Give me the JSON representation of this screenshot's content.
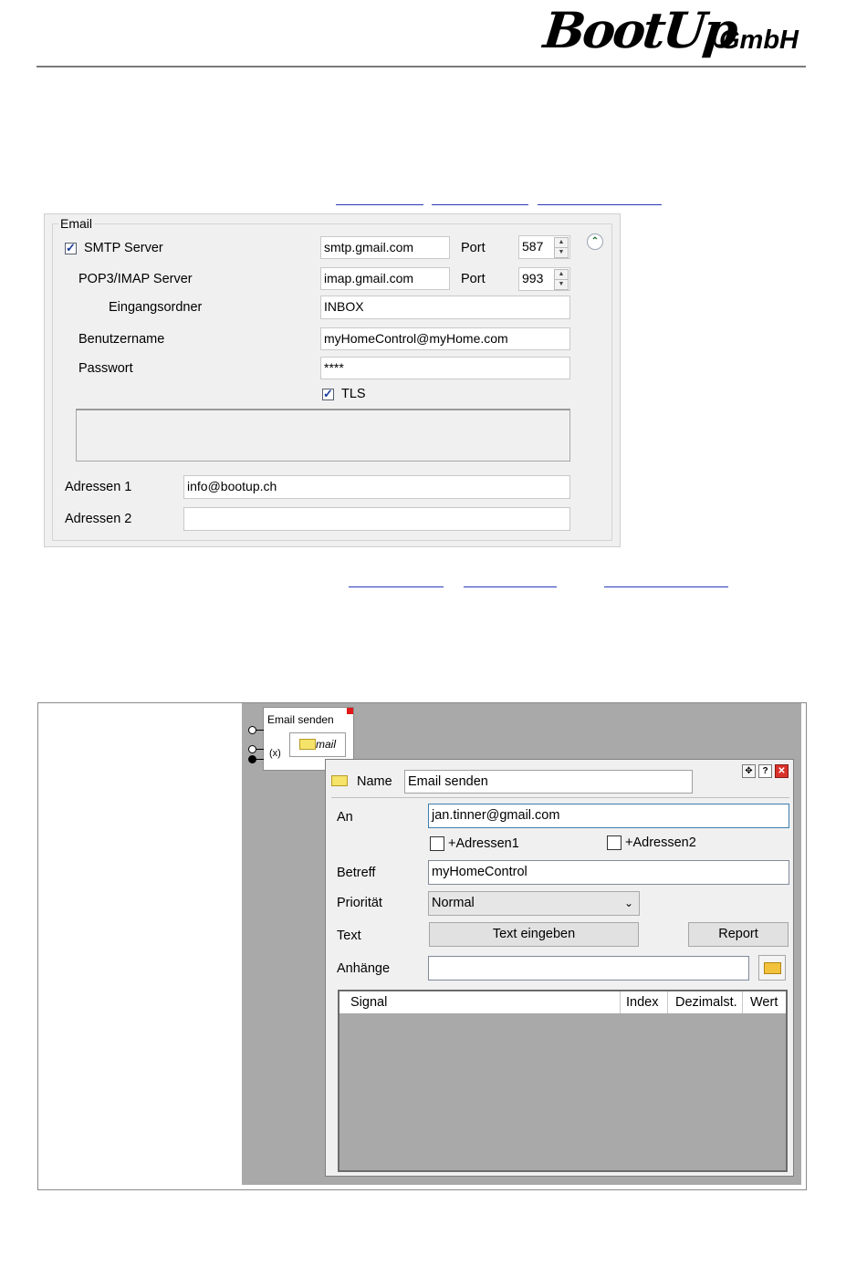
{
  "header": {
    "logo_main": "BootUp",
    "logo_suffix": "GmbH"
  },
  "email_panel": {
    "group_title": "Email",
    "smtp_label": "SMTP Server",
    "smtp_checked": true,
    "smtp_value": "smtp.gmail.com",
    "smtp_port_label": "Port",
    "smtp_port": "587",
    "pop_label": "POP3/IMAP Server",
    "pop_value": "imap.gmail.com",
    "pop_port_label": "Port",
    "pop_port": "993",
    "inbox_label": "Eingangsordner",
    "inbox_value": "INBOX",
    "user_label": "Benutzername",
    "user_value": "myHomeControl@myHome.com",
    "password_label": "Passwort",
    "password_value": "****",
    "tls_label": "TLS",
    "tls_checked": true,
    "addr1_label": "Adressen 1",
    "addr1_value": "info@bootup.ch",
    "addr2_label": "Adressen 2",
    "addr2_value": ""
  },
  "block": {
    "title": "Email senden",
    "port_label": "(x)",
    "icon_text": "mail"
  },
  "dialog": {
    "name_label": "Name",
    "name_value": "Email senden",
    "to_label": "An",
    "to_value": "jan.tinner@gmail.com",
    "addr1_option": "+Adressen1",
    "addr2_option": "+Adressen2",
    "subject_label": "Betreff",
    "subject_value": "myHomeControl",
    "priority_label": "Priorität",
    "priority_value": "Normal",
    "text_label": "Text",
    "text_button": "Text eingeben",
    "report_button": "Report",
    "attachments_label": "Anhänge",
    "attachments_value": "",
    "table_columns": [
      "Signal",
      "Index",
      "Dezimalst.",
      "Wert"
    ]
  }
}
